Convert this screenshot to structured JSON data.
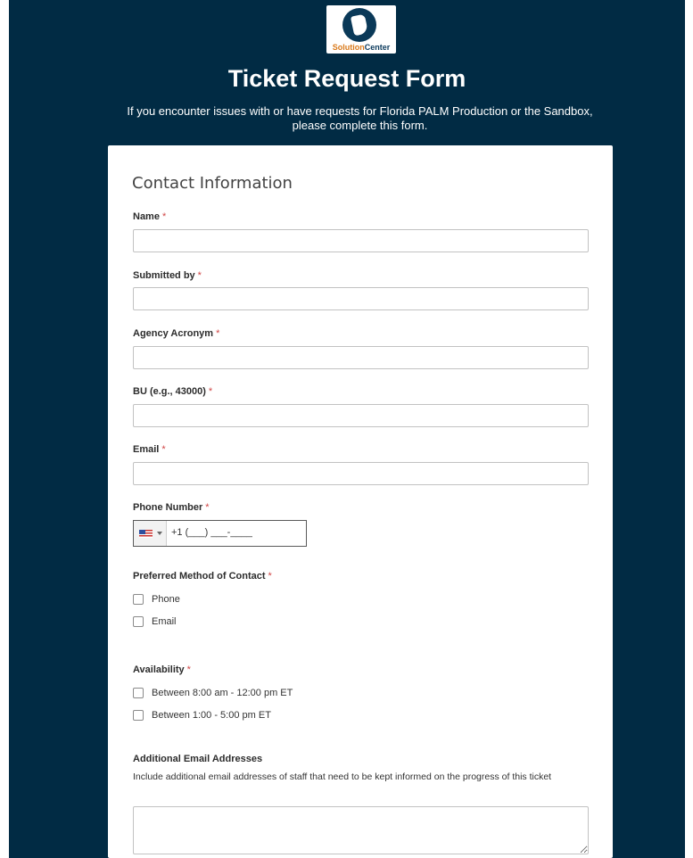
{
  "header": {
    "logo_text_bold": "Solution",
    "logo_text_light": "Center",
    "title": "Ticket Request Form",
    "subtitle": "If you encounter issues with or have requests for Florida PALM Production or the Sandbox, please complete this form."
  },
  "form": {
    "section_title": "Contact Information",
    "required_mark": "*",
    "fields": {
      "name": {
        "label": "Name",
        "value": ""
      },
      "submitted_by": {
        "label": "Submitted by",
        "value": ""
      },
      "agency_acronym": {
        "label": "Agency Acronym",
        "value": ""
      },
      "bu": {
        "label": "BU (e.g., 43000)",
        "value": ""
      },
      "email": {
        "label": "Email",
        "value": ""
      },
      "phone": {
        "label": "Phone Number",
        "value": "+1 (___) ___-____",
        "country_icon": "us-flag-icon"
      }
    },
    "preferred_contact": {
      "label": "Preferred Method of Contact",
      "options": [
        "Phone",
        "Email"
      ]
    },
    "availability": {
      "label": "Availability",
      "options": [
        "Between 8:00 am - 12:00 pm ET",
        "Between 1:00 - 5:00 pm ET"
      ]
    },
    "additional_emails": {
      "label": "Additional Email Addresses",
      "help": "Include additional email addresses of staff that need to be kept informed on the progress of this ticket"
    }
  },
  "colors": {
    "background": "#012b44",
    "required": "#d04545",
    "card": "#ffffff"
  }
}
